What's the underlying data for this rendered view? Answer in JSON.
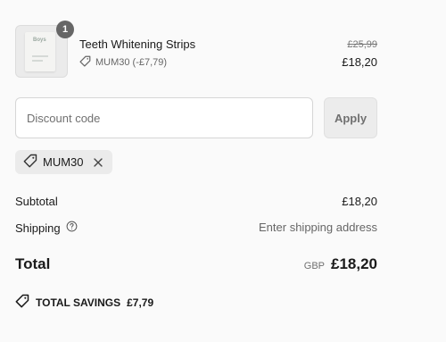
{
  "item": {
    "name": "Teeth Whitening Strips",
    "quantity": "1",
    "box_brand": "Boys",
    "discount_label": "MUM30 (-£7,79)",
    "original_price": "£25,99",
    "price": "£18,20"
  },
  "discount": {
    "placeholder": "Discount code",
    "apply_label": "Apply",
    "applied_code": "MUM30"
  },
  "summary": {
    "subtotal_label": "Subtotal",
    "subtotal_value": "£18,20",
    "shipping_label": "Shipping",
    "shipping_value": "Enter shipping address",
    "total_label": "Total",
    "currency": "GBP",
    "total_value": "£18,20",
    "savings_label": "TOTAL SAVINGS",
    "savings_value": "£7,79"
  }
}
